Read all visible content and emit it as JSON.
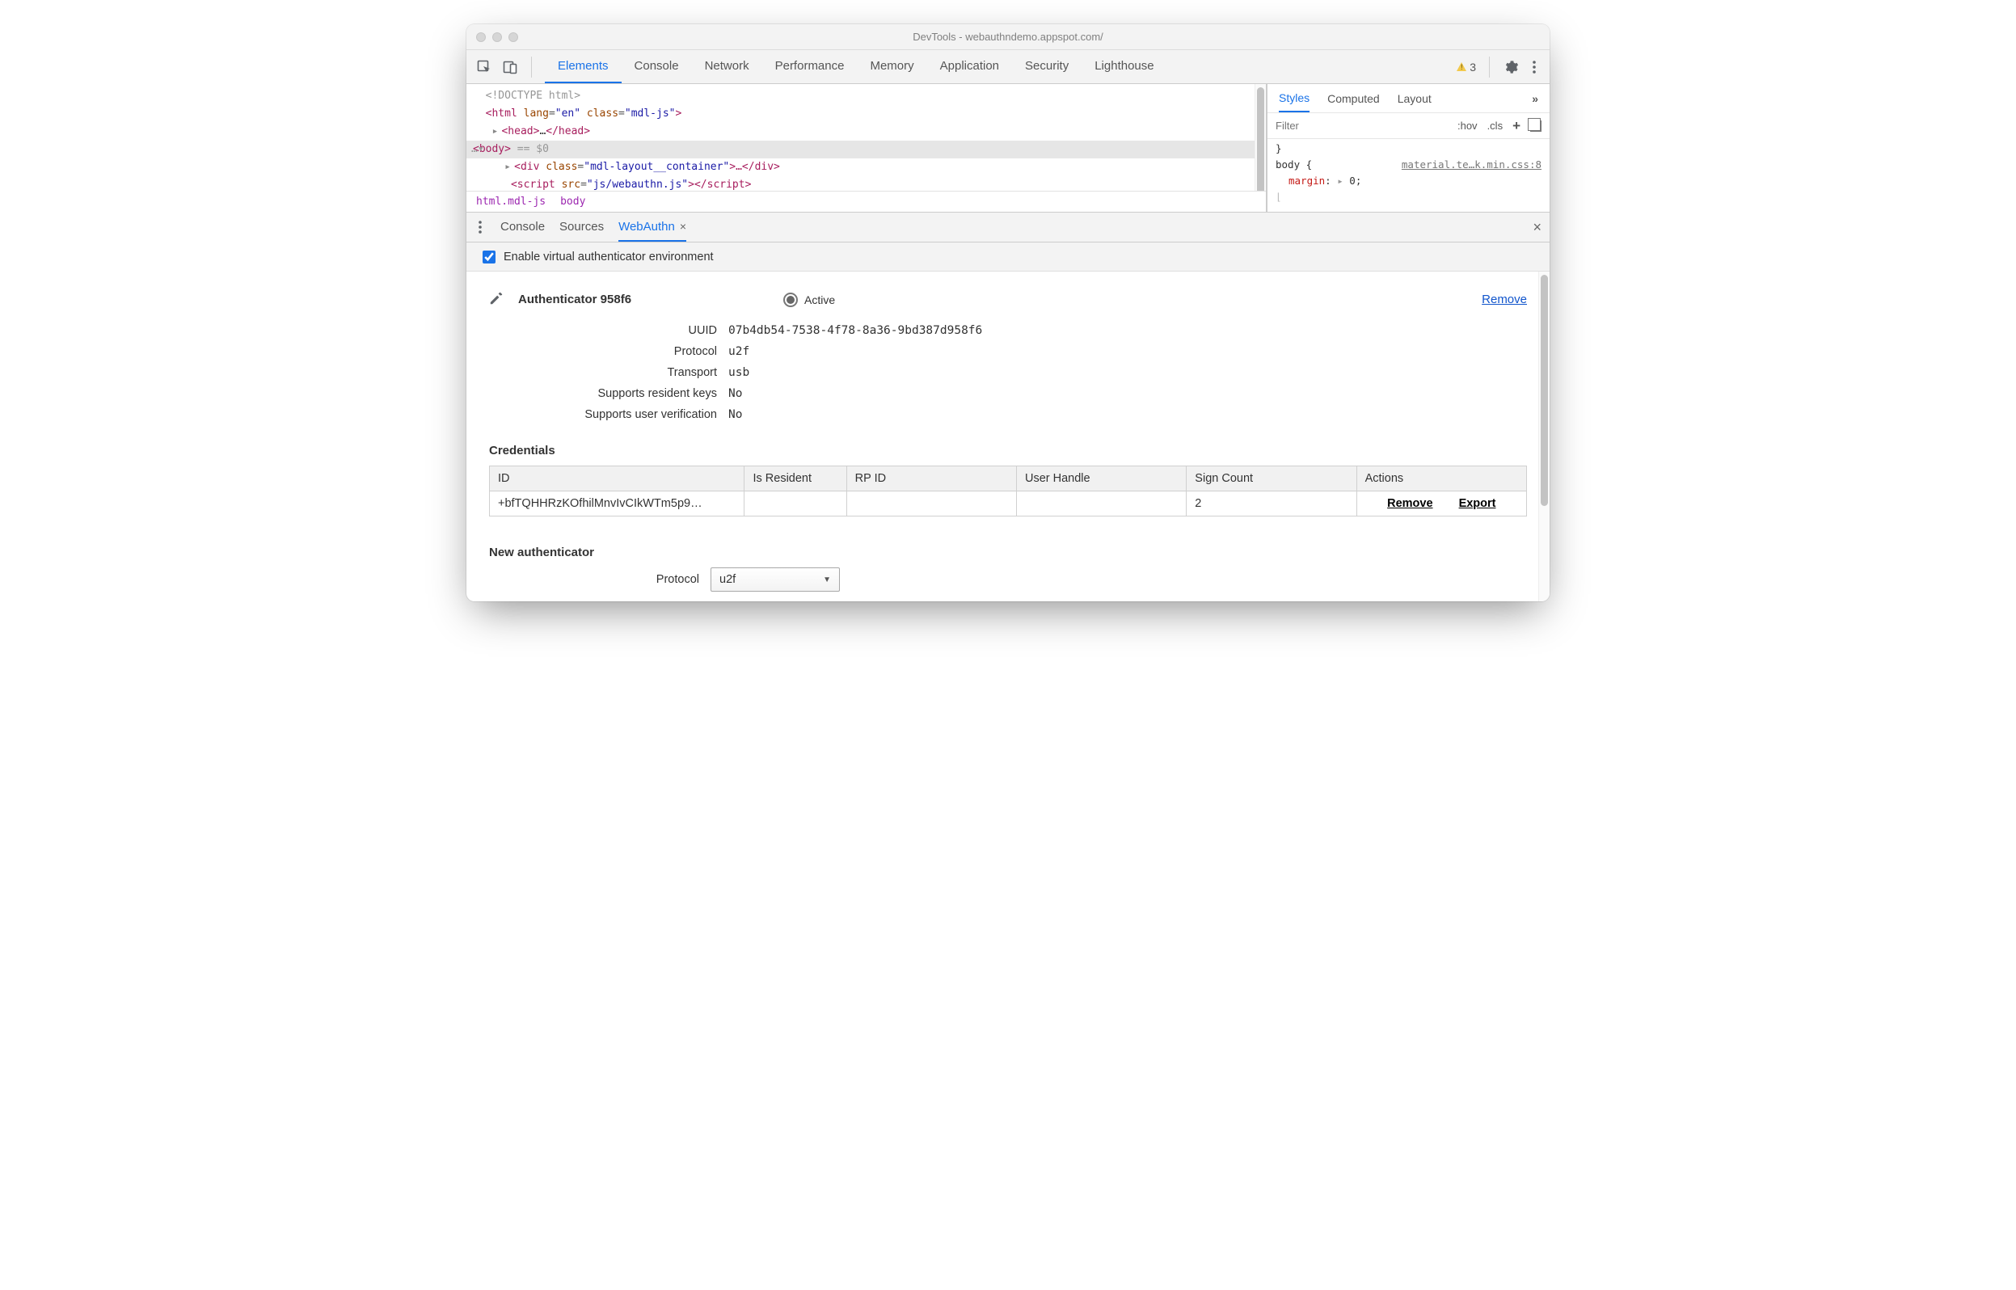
{
  "window": {
    "title": "DevTools - webauthndemo.appspot.com/"
  },
  "topTabs": {
    "items": [
      "Elements",
      "Console",
      "Network",
      "Performance",
      "Memory",
      "Application",
      "Security",
      "Lighthouse"
    ],
    "active": "Elements",
    "warningCount": "3"
  },
  "dom": {
    "line1": "<!DOCTYPE html>",
    "line2_open": "<",
    "line2_tag": "html",
    "line2_attr1n": "lang",
    "line2_attr1v": "\"en\"",
    "line2_attr2n": "class",
    "line2_attr2v": "\"mdl-js\"",
    "line2_close": ">",
    "line3_head_open": "<head>",
    "line3_head_dots": "…",
    "line3_head_close": "</head>",
    "line4_prefix": "…▾ ",
    "line4_body_open": "<body>",
    "line4_eq": " == $0",
    "line5_div_open": "<div ",
    "line5_attr_n": "class",
    "line5_attr_v": "\"mdl-layout__container\"",
    "line5_div_mid": ">…",
    "line5_div_close": "</div>",
    "line6_script_open": "<script ",
    "line6_attr_n": "src",
    "line6_attr_v": "\"js/webauthn.js\"",
    "line6_script_mid": ">",
    "line6_script_close": "</script>"
  },
  "breadcrumbs": {
    "a": "html.mdl-js",
    "b": "body"
  },
  "stylesTabs": {
    "items": [
      "Styles",
      "Computed",
      "Layout"
    ],
    "more": "»"
  },
  "stylesFilter": {
    "placeholder": "Filter",
    "hov": ":hov",
    "cls": ".cls",
    "plus": "+"
  },
  "stylesBody": {
    "braceTop": "}",
    "selector": "body {",
    "link": "material.te…k.min.css:8",
    "propName": "margin",
    "propVal": "0",
    "tri": "▸",
    "braceBot": "⌊"
  },
  "drawerTabs": {
    "items": [
      "Console",
      "Sources",
      "WebAuthn"
    ],
    "active": "WebAuthn"
  },
  "enable": {
    "label": "Enable virtual authenticator environment",
    "checked": true
  },
  "auth": {
    "title": "Authenticator 958f6",
    "activeLabel": "Active",
    "removeLabel": "Remove",
    "kv": {
      "uuid_k": "UUID",
      "uuid_v": "07b4db54-7538-4f78-8a36-9bd387d958f6",
      "protocol_k": "Protocol",
      "protocol_v": "u2f",
      "transport_k": "Transport",
      "transport_v": "usb",
      "srk_k": "Supports resident keys",
      "srk_v": "No",
      "suv_k": "Supports user verification",
      "suv_v": "No"
    }
  },
  "credentials": {
    "heading": "Credentials",
    "headers": {
      "id": "ID",
      "isResident": "Is Resident",
      "rpId": "RP ID",
      "userHandle": "User Handle",
      "signCount": "Sign Count",
      "actions": "Actions"
    },
    "row": {
      "id": "+bfTQHHRzKOfhilMnvIvCIkWTm5p9…",
      "isResident": "",
      "rpId": "",
      "userHandle": "",
      "signCount": "2",
      "remove": "Remove",
      "export": "Export"
    }
  },
  "newAuth": {
    "heading": "New authenticator",
    "protocolLabel": "Protocol",
    "protocolValue": "u2f"
  }
}
